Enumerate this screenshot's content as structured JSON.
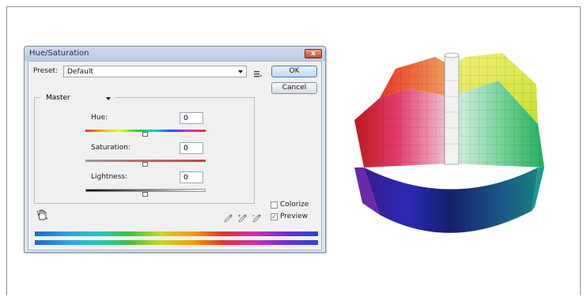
{
  "window": {
    "title": "Hue/Saturation",
    "close_glyph": "x"
  },
  "preset": {
    "label": "Preset:",
    "value": "Default",
    "options_icon": "list-icon"
  },
  "buttons": {
    "ok": "OK",
    "cancel": "Cancel"
  },
  "channel": {
    "value": "Master"
  },
  "hue": {
    "label": "Hue:",
    "value": "0"
  },
  "saturation": {
    "label": "Saturation:",
    "value": "0"
  },
  "lightness": {
    "label": "Lightness:",
    "value": "0"
  },
  "options": {
    "colorize": {
      "label": "Colorize",
      "checked": false
    },
    "preview": {
      "label": "Preview",
      "checked": true,
      "check_glyph": "✓"
    }
  },
  "tools": {
    "hand_icon": "targeted-adjustment-icon",
    "eyedroppers": [
      "eyedropper-icon",
      "eyedropper-plus-icon",
      "eyedropper-minus-icon"
    ]
  },
  "colors": {
    "accent": "#3c7fb1",
    "window_bg": "#f0f0f0",
    "titlebar": "#c5d5ea"
  }
}
